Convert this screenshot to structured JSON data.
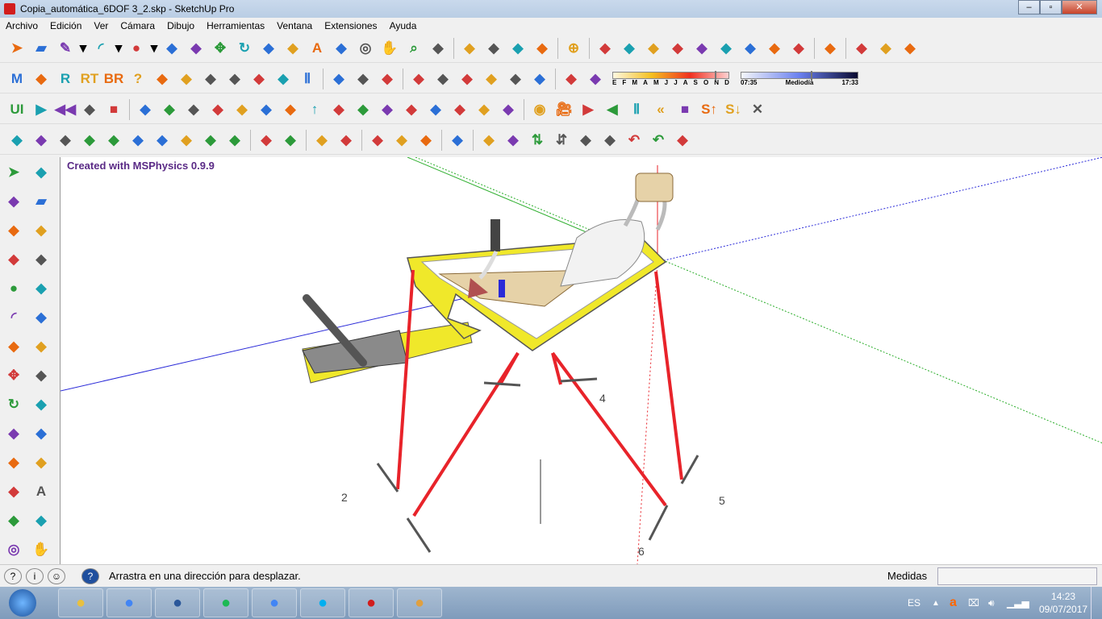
{
  "window": {
    "title": "Copia_automática_6DOF 3_2.skp - SketchUp Pro",
    "buttons": {
      "minimize": "–",
      "maximize": "▫",
      "close": "✕"
    }
  },
  "menu": [
    "Archivo",
    "Edición",
    "Ver",
    "Cámara",
    "Dibujo",
    "Herramientas",
    "Ventana",
    "Extensiones",
    "Ayuda"
  ],
  "toolbars": {
    "row1": [
      "select",
      "eraser",
      "pencil",
      "dropdown",
      "arc",
      "dropdown",
      "circle",
      "dropdown",
      "push-pull",
      "follow-me",
      "move",
      "rotate",
      "scale",
      "tape-measure",
      "text",
      "paint-bucket",
      "orbit",
      "pan",
      "zoom",
      "zoom-extents",
      "|",
      "3d-warehouse",
      "extension-warehouse",
      "components",
      "send-to-layout",
      "|",
      "globe",
      "|",
      "styles-color",
      "red-line",
      "blue-line",
      "yellow-line",
      "green-square",
      "brown-square",
      "cyan-square",
      "orange-square",
      "black-square",
      "|",
      "xray",
      "|",
      "plugin-a",
      "plugin-b",
      "plugin-c"
    ],
    "row2": [
      "m",
      "tag",
      "r",
      "rt",
      "br",
      "help",
      "tag2",
      "sphere",
      "plane",
      "landscape1",
      "landscape2",
      "target",
      "pause",
      "|",
      "red-box",
      "blue-box",
      "gray-box",
      "|",
      "sun-sphere",
      "lamp",
      "cone",
      "dome",
      "half-sphere",
      "moon",
      "|",
      "shadow-toggle",
      "shadow-display"
    ],
    "row3": [
      "ui",
      "play",
      "rewind",
      "step",
      "stop",
      "|",
      "refresh",
      "joint",
      "link1",
      "link2",
      "link3",
      "axis-red",
      "axis-green",
      "arrow-up",
      "spring",
      "pivot",
      "gear",
      "servo",
      "plane-joint",
      "slider1",
      "slider2",
      "plate",
      "|",
      "record",
      "camera",
      "play2",
      "back",
      "pause2",
      "rewind2",
      "stop2",
      "s-up",
      "s-down",
      "close"
    ],
    "row4": [
      "sandbox",
      "pencil-sb",
      "rect-sb",
      "circle-sb",
      "hex-sb",
      "ellipse-sb",
      "para-sb",
      "arc-sb",
      "circle2-sb",
      "cone-sb",
      "|",
      "polygon",
      "spline",
      "|",
      "arrow-red",
      "eraser-pink",
      "|",
      "cube1",
      "cube2",
      "cube3",
      "|",
      "tag-yellow",
      "|",
      "mirror",
      "flip",
      "up-down",
      "down-up",
      "diag",
      "hourglass",
      "undo-blue",
      "undo-red",
      "pdf"
    ]
  },
  "shadow": {
    "months": [
      "E",
      "F",
      "M",
      "A",
      "M",
      "J",
      "J",
      "A",
      "S",
      "O",
      "N",
      "D"
    ],
    "month_value": 0.88,
    "time_start": "07:35",
    "time_mid": "Mediodía",
    "time_end": "17:33",
    "time_value": 0.6
  },
  "lefttools": [
    "select",
    "component",
    "paint",
    "eraser",
    "line",
    "freehand",
    "rectangle",
    "rotated-rect",
    "circle",
    "polygon",
    "arc",
    "arc2",
    "pie",
    "3pt-arc",
    "move",
    "push-pull",
    "rotate",
    "follow-me",
    "scale",
    "offset",
    "tape",
    "dimension",
    "protractor",
    "text",
    "axes",
    "3d-text",
    "orbit",
    "pan"
  ],
  "viewport": {
    "note": "Created with MSPhysics 0.9.9",
    "labels": [
      "2",
      "4",
      "5",
      "6"
    ]
  },
  "statusbar": {
    "message": "Arrastra en una dirección para desplazar.",
    "measure_label": "Medidas",
    "measure_value": ""
  },
  "taskbar": {
    "apps": [
      "explorer",
      "chrome",
      "word",
      "spotify",
      "chrome2",
      "skype",
      "sketchup",
      "paint"
    ],
    "lang": "ES",
    "time": "14:23",
    "date": "09/07/2017"
  },
  "colors": {
    "accent": "#5a2a86",
    "frame": "#f0e82a",
    "actuator": "#e8232a"
  }
}
